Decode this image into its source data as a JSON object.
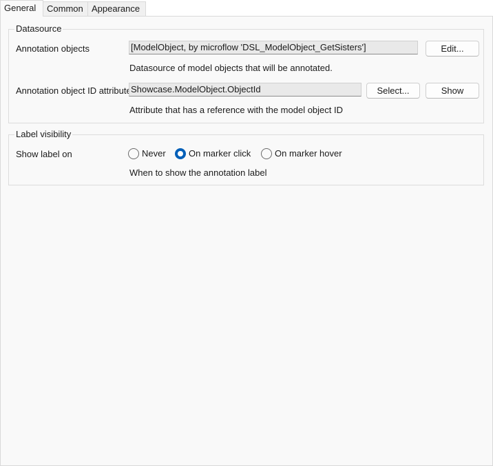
{
  "tabs": [
    {
      "label": "General"
    },
    {
      "label": "Common"
    },
    {
      "label": "Appearance"
    }
  ],
  "datasource": {
    "legend": "Datasource",
    "annotation_objects": {
      "label": "Annotation objects",
      "value": "[ModelObject, by microflow 'DSL_ModelObject_GetSisters']",
      "edit_label": "Edit...",
      "description": "Datasource of model objects that will be annotated."
    },
    "id_attribute": {
      "label": "Annotation object ID attribute",
      "value": "Showcase.ModelObject.ObjectId",
      "select_label": "Select...",
      "show_label": "Show",
      "description": "Attribute that has a reference with the model object ID"
    }
  },
  "label_visibility": {
    "legend": "Label visibility",
    "show_label_on": "Show label on",
    "options": [
      {
        "label": "Never",
        "checked": false
      },
      {
        "label": "On marker click",
        "checked": true
      },
      {
        "label": "On marker hover",
        "checked": false
      }
    ],
    "description": "When to show the annotation label"
  }
}
